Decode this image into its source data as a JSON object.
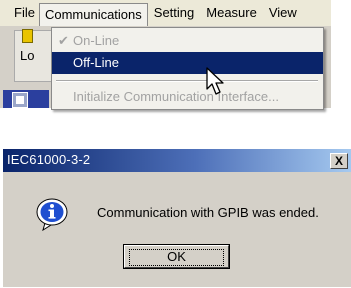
{
  "menubar": {
    "items": [
      "File",
      "Communications",
      "Setting",
      "Measure",
      "View"
    ]
  },
  "toolbar": {
    "button_label": "Lo"
  },
  "communications_menu": {
    "online_check": "✔",
    "online_label": "On-Line",
    "offline_label": "Off-Line",
    "initialize_label": "Initialize Communication Interface..."
  },
  "dialog": {
    "title": "IEC61000-3-2",
    "close_glyph": "X",
    "message": "Communication with GPIB was ended.",
    "ok_label": "OK"
  },
  "colors": {
    "menu_highlight": "#0a246a",
    "title_gradient_start": "#0a246a",
    "title_gradient_end": "#a6caf0",
    "dialog_face": "#d4d0c8"
  },
  "icons": [
    "info-icon",
    "cursor-arrow-icon",
    "grid-icon",
    "document-icon",
    "check-icon"
  ]
}
